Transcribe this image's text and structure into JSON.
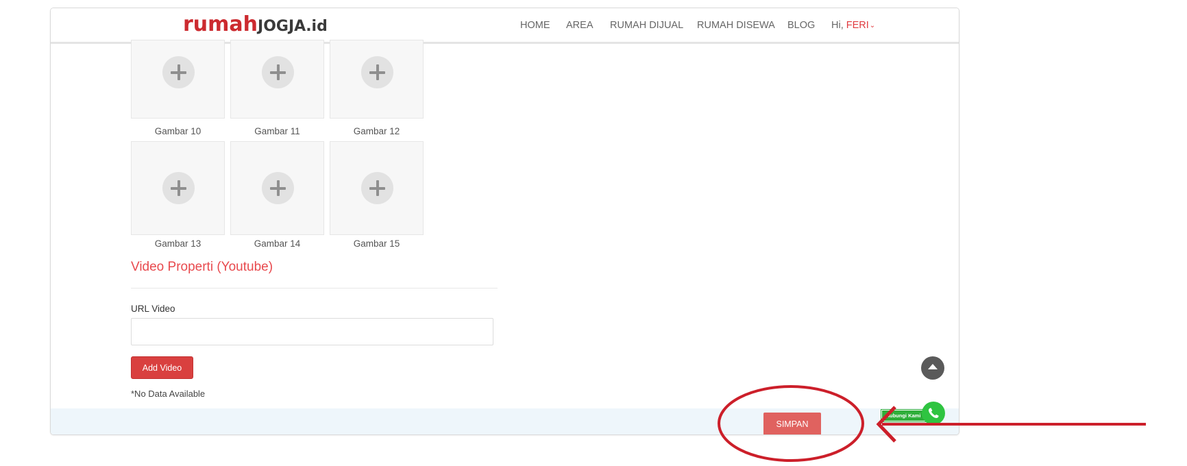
{
  "brand": {
    "rumah": "rumah",
    "jogja": "JOGJA",
    "id": ".id"
  },
  "nav": {
    "home": "HOME",
    "area": "AREA",
    "dijual": "RUMAH DIJUAL",
    "disewa": "RUMAH DISEWA",
    "blog": "BLOG",
    "greeting": "Hi, ",
    "user": "FERI",
    "chevron": "⌄"
  },
  "gallery": [
    {
      "label": "Gambar 10"
    },
    {
      "label": "Gambar 11"
    },
    {
      "label": "Gambar 12"
    },
    {
      "label": "Gambar 13"
    },
    {
      "label": "Gambar 14"
    },
    {
      "label": "Gambar 15"
    }
  ],
  "video": {
    "section_title": "Video Properti (Youtube)",
    "url_label": "URL Video",
    "url_value": "",
    "add_button": "Add Video",
    "empty_text": "*No Data Available"
  },
  "footer": {
    "save_button": "SIMPAN"
  },
  "floating": {
    "whatsapp_badge": "Hubungi Kami"
  },
  "colors": {
    "brand_red": "#cc2a2f",
    "accent": "#e84a4e",
    "button_red": "#d9403f",
    "whatsapp": "#2fc441",
    "annotation": "#cc1f2a"
  }
}
